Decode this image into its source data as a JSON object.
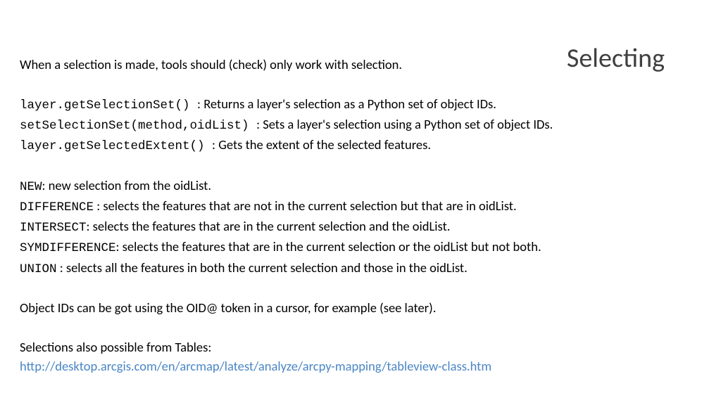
{
  "title": "Selecting",
  "intro": "When a selection is made, tools should (check) only work with selection.",
  "api": [
    {
      "code": "layer.getSelectionSet()       ",
      "sep": ": ",
      "desc": "Returns a layer's selection as a Python set of object IDs."
    },
    {
      "code": "setSelectionSet(method,oidList) ",
      "sep": " : ",
      "desc": "Sets a layer's selection using a Python set of object IDs."
    },
    {
      "code": "layer.getSelectedExtent()  ",
      "sep": " : ",
      "desc": "Gets the extent of the selected features."
    }
  ],
  "methods": [
    {
      "code": "NEW",
      "sep": ": ",
      "desc": "new selection from the oidList."
    },
    {
      "code": "DIFFERENCE",
      "sep": " : ",
      "desc": "selects the features that are not in the current selection but that are in oidList."
    },
    {
      "code": "INTERSECT",
      "sep": ": ",
      "desc": "selects the features that are in the current selection and the oidList."
    },
    {
      "code": "SYMDIFFERENCE",
      "sep": ": ",
      "desc": "selects the features that are in the current selection or the oidList but not both."
    },
    {
      "code": "UNION",
      "sep": " : ",
      "desc": "selects all the features in both the current selection and those in the oidList."
    }
  ],
  "oid_para": "Object IDs can be got using the OID@ token in a cursor, for example (see later).",
  "tables_intro": "Selections also possible from Tables:",
  "link": "http://desktop.arcgis.com/en/arcmap/latest/analyze/arcpy-mapping/tableview-class.htm"
}
